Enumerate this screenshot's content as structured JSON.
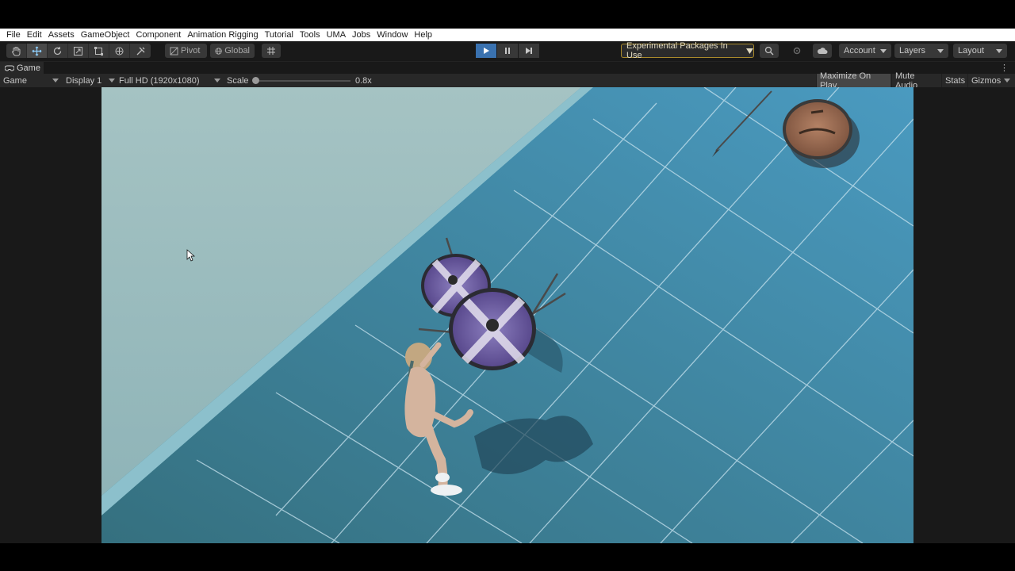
{
  "menu": {
    "items": [
      "File",
      "Edit",
      "Assets",
      "GameObject",
      "Component",
      "Animation Rigging",
      "Tutorial",
      "Tools",
      "UMA",
      "Jobs",
      "Window",
      "Help"
    ]
  },
  "toolbar": {
    "pivot_label": "Pivot",
    "global_label": "Global",
    "experimental_label": "Experimental Packages In Use",
    "account_label": "Account",
    "layers_label": "Layers",
    "layout_label": "Layout",
    "play_accent": "#3a72b0"
  },
  "tab": {
    "label": "Game"
  },
  "gamebar": {
    "mode": "Game",
    "display": "Display 1",
    "resolution": "Full HD (1920x1080)",
    "scale_label": "Scale",
    "scale_value": "0.8x",
    "maximize": "Maximize On Play",
    "mute": "Mute Audio",
    "stats": "Stats",
    "gizmos": "Gizmos"
  },
  "colors": {
    "floor": "#3b7a98",
    "wall": "#a9c8ca",
    "shield_purple": "#6b5a9e",
    "shield_wood": "#9a6a4f"
  }
}
